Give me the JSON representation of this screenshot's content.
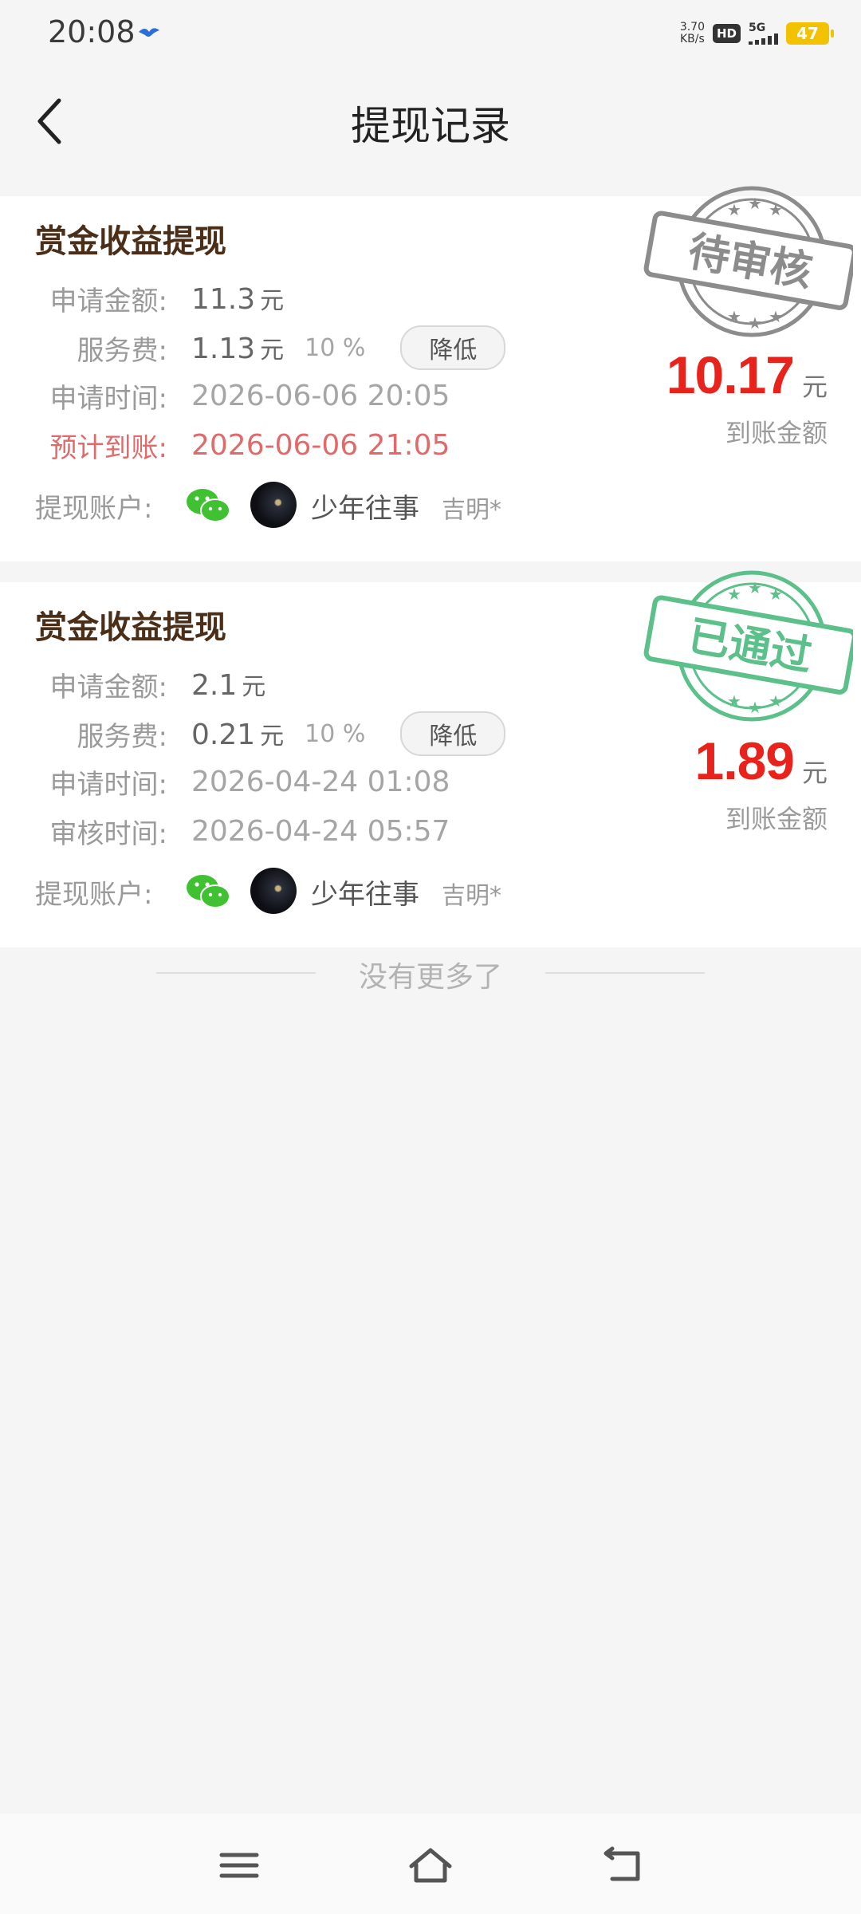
{
  "status_bar": {
    "time": "20:08",
    "net_speed_value": "3.70",
    "net_speed_unit": "KB/s",
    "hd": "HD",
    "signal": "5G",
    "battery": "47"
  },
  "header": {
    "title": "提现记录"
  },
  "records": [
    {
      "title": "赏金收益提现",
      "apply_amount_label": "申请金额:",
      "apply_amount": "11.3",
      "unit": "元",
      "fee_label": "服务费:",
      "fee": "1.13",
      "fee_rate": "10 %",
      "reduce_label": "降低",
      "time_label": "申请时间:",
      "time": "2026-06-06 20:05",
      "extra_label": "预计到账:",
      "extra_time": "2026-06-06 21:05",
      "account_label": "提现账户:",
      "nickname": "少年往事",
      "realname": "吉明*",
      "arrival_amount": "10.17",
      "arrival_unit": "元",
      "arrival_caption": "到账金额",
      "stamp_text": "待审核",
      "stamp_color": "#8c8c8c"
    },
    {
      "title": "赏金收益提现",
      "apply_amount_label": "申请金额:",
      "apply_amount": "2.1",
      "unit": "元",
      "fee_label": "服务费:",
      "fee": "0.21",
      "fee_rate": "10 %",
      "reduce_label": "降低",
      "time_label": "申请时间:",
      "time": "2026-04-24 01:08",
      "extra_label": "审核时间:",
      "extra_time": "2026-04-24 05:57",
      "account_label": "提现账户:",
      "nickname": "少年往事",
      "realname": "吉明*",
      "arrival_amount": "1.89",
      "arrival_unit": "元",
      "arrival_caption": "到账金额",
      "stamp_text": "已通过",
      "stamp_color": "#5cc08a"
    }
  ],
  "footer": {
    "no_more": "没有更多了"
  },
  "colors": {
    "accent_red": "#e8231c",
    "title_brown": "#4a2e18",
    "wechat_green": "#3fc131"
  }
}
